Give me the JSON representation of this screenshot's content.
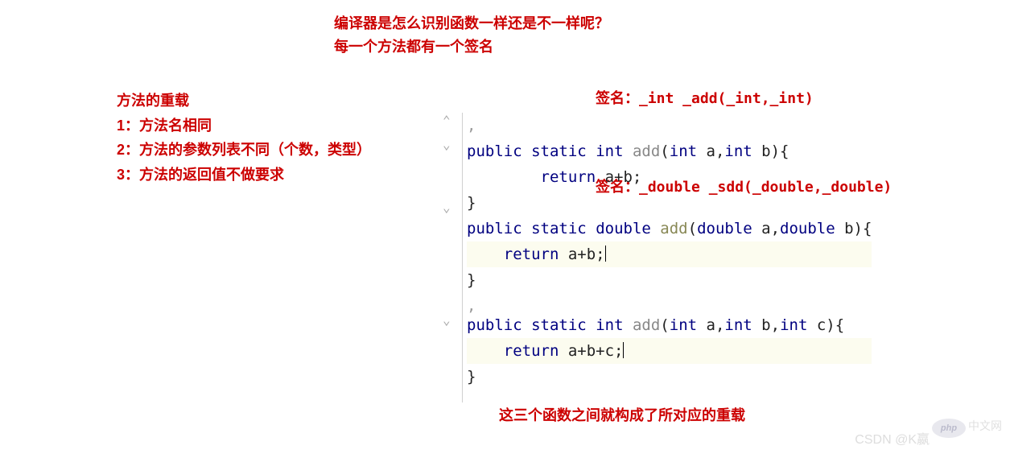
{
  "topTitle": {
    "line1": "编译器是怎么识别函数一样还是不一样呢？",
    "line2": "每一个方法都有一个签名"
  },
  "leftNotes": {
    "heading": "方法的重载",
    "rule1": "1：方法名相同",
    "rule2": "2：方法的参数列表不同（个数，类型）",
    "rule3": "3：方法的返回值不做要求"
  },
  "signature1": "签名：_int  _add(_int,_int)",
  "signature2": "签名：_double _sdd(_double,_double)",
  "code": {
    "line0": ",",
    "line1": {
      "public": "public",
      "static": "static",
      "int": "int",
      "add": "add",
      "params": "(",
      "int_a": "int",
      "a": " a,",
      "int_b": "int",
      "b": " b){"
    },
    "line2": {
      "return": "return",
      "expr": " a+b;"
    },
    "line3": "}",
    "line4": {
      "public": "public",
      "static": "static",
      "double": "double",
      "add": "add",
      "params": "(",
      "double_a": "double",
      "a": " a,",
      "double_b": "double",
      "b": " b){"
    },
    "line5": {
      "return": "return",
      "expr": " a+b;"
    },
    "line6": "}",
    "line7": ",",
    "line8": {
      "public": "public",
      "static": "static",
      "int": "int",
      "add": "add",
      "params": "(",
      "int_a": "int",
      "a": " a,",
      "int_b": "int",
      "b": " b,",
      "int_c": "int",
      "c": " c){"
    },
    "line9": {
      "return": "return",
      "expr": " a+b+c;"
    },
    "line10": "}"
  },
  "bottomNote": "这三个函数之间就构成了所对应的重载",
  "watermark1": "CSDN @K嬴",
  "watermark2": "中文网",
  "phpLogo": "php"
}
